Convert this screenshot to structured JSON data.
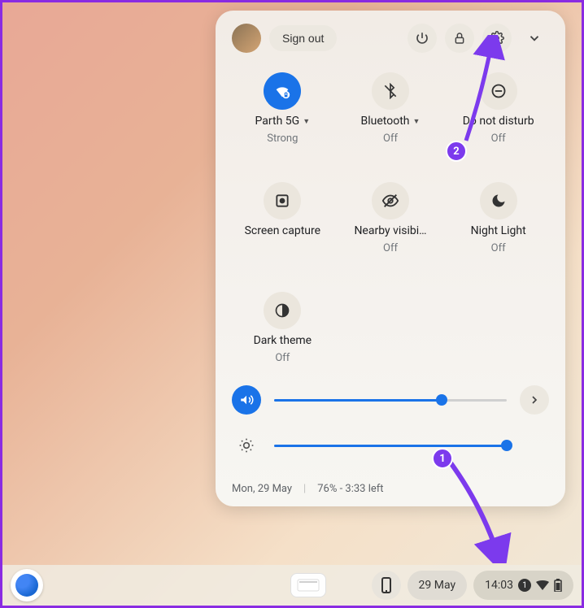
{
  "header": {
    "sign_out": "Sign out",
    "chevron": "▾"
  },
  "tiles": {
    "wifi": {
      "label": "Parth 5G",
      "status": "Strong"
    },
    "bt": {
      "label": "Bluetooth",
      "status": "Off"
    },
    "dnd": {
      "label": "Do not disturb",
      "status": "Off"
    },
    "cap": {
      "label": "Screen capture",
      "status": ""
    },
    "nearby": {
      "label": "Nearby visibi…",
      "status": "Off"
    },
    "night": {
      "label": "Night Light",
      "status": "Off"
    },
    "dark": {
      "label": "Dark theme",
      "status": "Off"
    }
  },
  "sliders": {
    "volume": 72,
    "brightness": 100
  },
  "footer": {
    "date": "Mon, 29 May",
    "battery": "76% - 3:33 left"
  },
  "taskbar": {
    "date": "29 May",
    "time": "14:03",
    "notif_count": "1"
  },
  "annotations": {
    "a1": "1",
    "a2": "2"
  }
}
